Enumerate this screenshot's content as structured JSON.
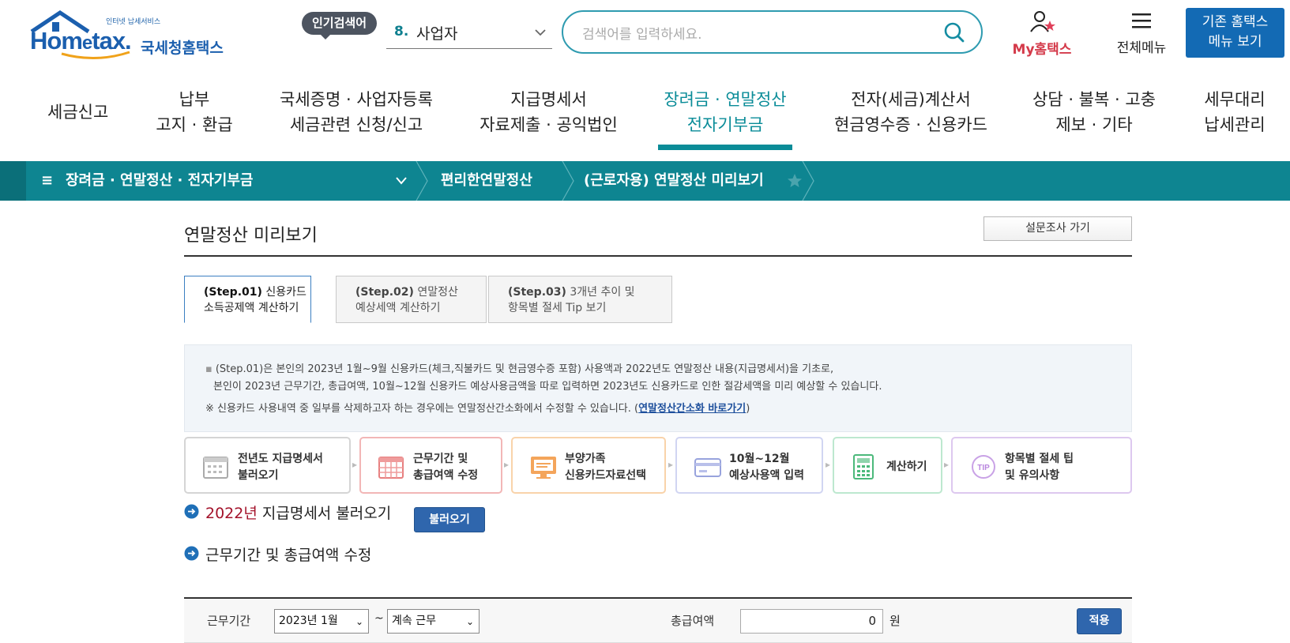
{
  "header": {
    "logo_sub": "인터넷 납세서비스",
    "logo_main_a": "Hom",
    "logo_main_e": "e",
    "logo_main_b": "tax.",
    "logo_kr": "국세청홈택스",
    "popular_label": "인기검색어",
    "popular_number": "8.",
    "popular_word": "사업자",
    "search_placeholder": "검색어를 입력하세요.",
    "my_label": "My홈택스",
    "all_menu_label": "전체메뉴",
    "old_menu_line1": "기존 홈택스",
    "old_menu_line2": "메뉴 보기"
  },
  "gnb": [
    {
      "line1": "세금신고",
      "line2": ""
    },
    {
      "line1": "납부",
      "line2": "고지 · 환급"
    },
    {
      "line1": "국세증명 · 사업자등록",
      "line2": "세금관련 신청/신고"
    },
    {
      "line1": "지급명세서",
      "line2": "자료제출 · 공익법인"
    },
    {
      "line1": "장려금 · 연말정산",
      "line2": "전자기부금"
    },
    {
      "line1": "전자(세금)계산서",
      "line2": "현금영수증 · 신용카드"
    },
    {
      "line1": "상담 · 불복 · 고충",
      "line2": "제보 · 기타"
    },
    {
      "line1": "세무대리",
      "line2": "납세관리"
    }
  ],
  "location": {
    "menu_icon": "≡",
    "level1": "장려금 · 연말정산 · 전자기부금",
    "level2": "편리한연말정산",
    "level3": "(근로자용) 연말정산 미리보기"
  },
  "page": {
    "title": "연말정산 미리보기",
    "survey_button": "설문조사 가기"
  },
  "tabs": [
    {
      "step": "(Step.01)",
      "line1": " 신용카드",
      "line2": "소득공제액 계산하기"
    },
    {
      "step": "(Step.02)",
      "line1": " 연말정산",
      "line2": "예상세액 계산하기"
    },
    {
      "step": "(Step.03)",
      "line1": " 3개년 추이 및",
      "line2": "항목별 절세 Tip 보기"
    }
  ],
  "info": {
    "bullet": "▪",
    "line1": "(Step.01)은 본인의 2023년 1월~9월 신용카드(체크,직불카드 및 현금영수증 포함) 사용액과 2022년도 연말정산 내용(지급명세서)을 기초로,",
    "line2": "본인이 2023년 근무기간, 총급여액, 10월~12월 신용카드 예상사용금액을 따로 입력하면 2023년도 신용카드로 인한 절감세액을 미리 예상할 수 있습니다.",
    "line3_prefix": "※ 신용카드 사용내역 중 일부를 삭제하고자 하는 경우에는 연말정산간소화에서 수정할 수 있습니다. (",
    "line3_link": "연말정산간소화 바로가기",
    "line3_suffix": ")"
  },
  "steps": [
    {
      "line1": "전년도 지급명세서",
      "line2": "불러오기",
      "icon": "calendar-icon",
      "color": "#c9c9c9"
    },
    {
      "line1": "근무기간 및",
      "line2": "총급여액 수정",
      "icon": "calendar-grid-icon",
      "color": "#f1b3b3"
    },
    {
      "line1": "부양가족",
      "line2": "신용카드자료선택",
      "icon": "monitor-icon",
      "color": "#f7d1a6"
    },
    {
      "line1": "10월~12월",
      "line2": "예상사용액 입력",
      "icon": "card-icon",
      "color": "#cdd2f0"
    },
    {
      "line1": "계산하기",
      "line2": "",
      "icon": "calculator-icon",
      "color": "#b8e6cc"
    },
    {
      "line1": "항목별 절세 팁",
      "line2": "및 유의사항",
      "icon": "tip-icon",
      "color": "#dcc6ee"
    }
  ],
  "section1": {
    "year": "2022년",
    "text": " 지급명세서 불러오기",
    "button": "불러오기"
  },
  "section2": {
    "text": "근무기간 및 총급여액 수정"
  },
  "form": {
    "period_label": "근무기간",
    "start_value": "2023년 1월",
    "tilde": "~",
    "end_value": "계속 근무",
    "salary_label": "총급여액",
    "salary_value": "0",
    "unit": "원",
    "apply_button": "적용"
  }
}
